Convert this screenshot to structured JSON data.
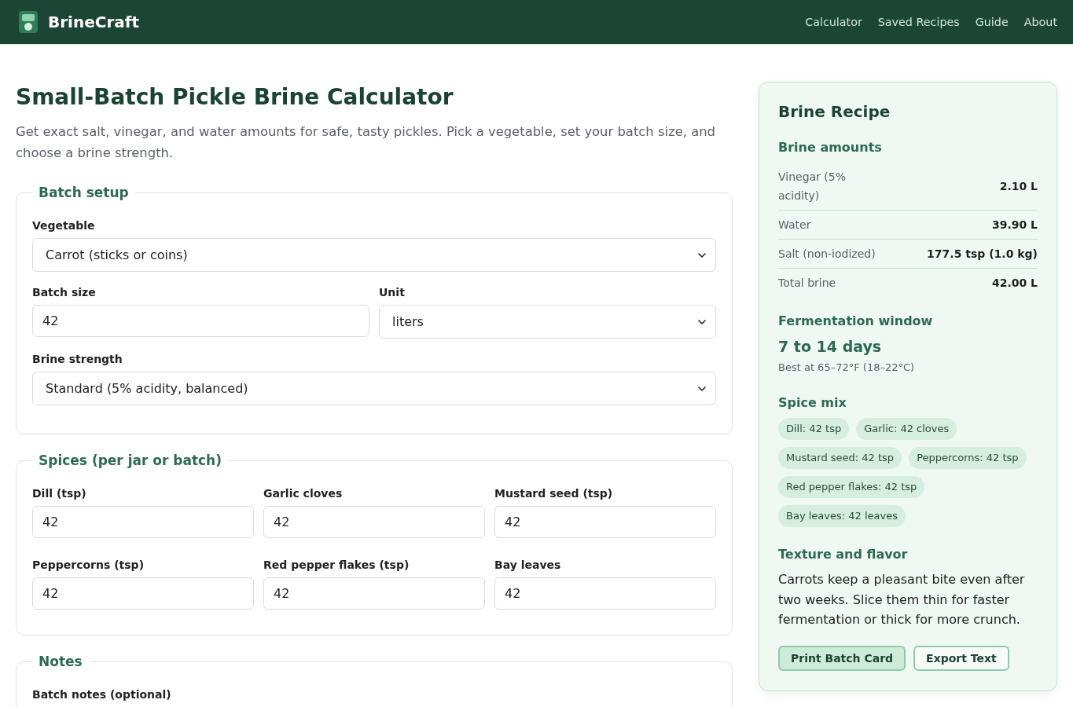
{
  "header": {
    "brand": "BrineCraft",
    "nav": [
      {
        "label": "Calculator"
      },
      {
        "label": "Saved Recipes"
      },
      {
        "label": "Guide"
      },
      {
        "label": "About"
      }
    ]
  },
  "intro": {
    "title": "Small-Batch Pickle Brine Calculator",
    "text": "Get exact salt, vinegar, and water amounts for safe, tasty pickles. Pick a vegetable, set your batch size, and choose a brine strength."
  },
  "sections": [
    {
      "legend": "Batch setup",
      "rows": [
        [
          {
            "label": "Vegetable",
            "kind": "select",
            "value": "Carrot (sticks or coins)"
          }
        ],
        [
          {
            "label": "Batch size",
            "kind": "input",
            "value": "42"
          },
          {
            "label": "Unit",
            "kind": "select",
            "value": "liters"
          }
        ],
        [
          {
            "label": "Brine strength",
            "kind": "select",
            "value": "Standard (5% acidity, balanced)"
          }
        ]
      ]
    },
    {
      "legend": "Spices (per jar or batch)",
      "rows": [
        [
          {
            "label": "Dill (tsp)",
            "kind": "input",
            "value": "42"
          },
          {
            "label": "Garlic cloves",
            "kind": "input",
            "value": "42"
          },
          {
            "label": "Mustard seed (tsp)",
            "kind": "input",
            "value": "42"
          }
        ],
        [
          {
            "label": "Peppercorns (tsp)",
            "kind": "input",
            "value": "42"
          },
          {
            "label": "Red pepper flakes (tsp)",
            "kind": "input",
            "value": "42"
          },
          {
            "label": "Bay leaves",
            "kind": "input",
            "value": "42"
          }
        ]
      ]
    },
    {
      "legend": "Notes",
      "rows": [
        [
          {
            "label": "Batch notes (optional)"
          }
        ]
      ]
    }
  ],
  "recipe": {
    "title": "Brine Recipe",
    "amounts": {
      "heading": "Brine amounts",
      "rows": [
        {
          "label": "Vinegar (5% acidity)",
          "value": "2.10 L"
        },
        {
          "label": "Water",
          "value": "39.90 L"
        },
        {
          "label": "Salt (non-iodized)",
          "value": "177.5 tsp (1.0 kg)"
        },
        {
          "label": "Total brine",
          "value": "42.00 L"
        }
      ]
    },
    "fermentation": {
      "heading": "Fermentation window",
      "range": "7 to 14 days",
      "note": "Best at 65–72°F (18–22°C)"
    },
    "spices": {
      "heading": "Spice mix",
      "chips": [
        "Dill: 42 tsp",
        "Garlic: 42 cloves",
        "Mustard seed: 42 tsp",
        "Peppercorns: 42 tsp",
        "Red pepper flakes: 42 tsp",
        "Bay leaves: 42 leaves"
      ]
    },
    "texture": {
      "heading": "Texture and flavor",
      "text": "Carrots keep a pleasant bite even after two weeks. Slice them thin for faster fermentation or thick for more crunch."
    },
    "buttons": [
      {
        "label": "Print Batch Card",
        "kind": "primary"
      },
      {
        "label": "Export Text",
        "kind": "secondary"
      }
    ]
  }
}
